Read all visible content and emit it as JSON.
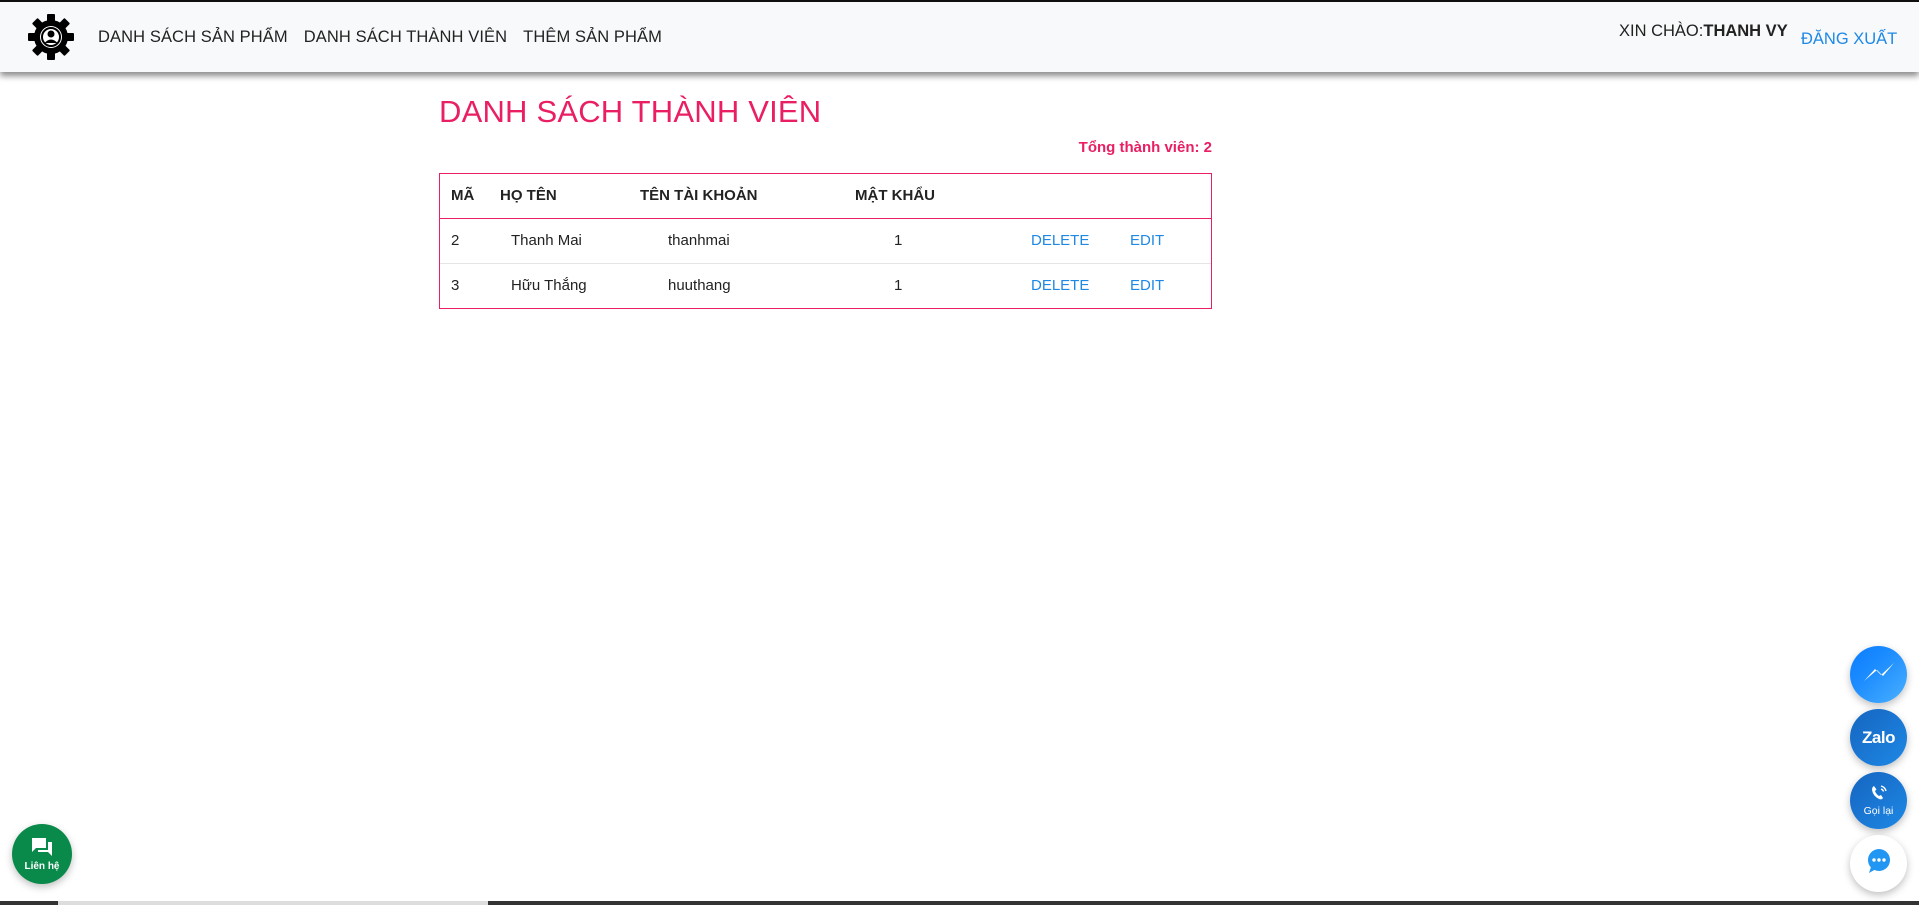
{
  "navbar": {
    "logo_icon": "gear-user-icon",
    "links": [
      {
        "label": "DANH SÁCH SẢN PHẨM"
      },
      {
        "label": "DANH SÁCH THÀNH VIÊN"
      },
      {
        "label": "THÊM SẢN PHẨM"
      }
    ],
    "greeting_prefix": "XIN CHÀO:",
    "greeting_name": "THANH VY",
    "logout_label": "ĐĂNG XUẤT"
  },
  "main": {
    "title": "DANH SÁCH THÀNH VIÊN",
    "total_label": "Tổng thành viên: 2",
    "table": {
      "headers": [
        "MÃ",
        "HỌ TÊN",
        "TÊN TÀI KHOẢN",
        "MẬT KHẨU"
      ],
      "rows": [
        {
          "id": "2",
          "name": "Thanh Mai",
          "username": "thanhmai",
          "password": "1",
          "delete": "DELETE",
          "edit": "EDIT"
        },
        {
          "id": "3",
          "name": "Hữu Thắng",
          "username": "huuthang",
          "password": "1",
          "delete": "DELETE",
          "edit": "EDIT"
        }
      ]
    }
  },
  "floating": {
    "messenger_icon": "messenger-icon",
    "zalo_label": "Zalo",
    "call_label": "Gọi lại",
    "chat_icon": "chat-bubble-icon",
    "contact_label": "Liên hệ"
  },
  "colors": {
    "accent": "#e91e63",
    "link": "#1e88e5",
    "navbar_bg": "#f8f9fa",
    "contact_green": "#0a8a4a"
  }
}
